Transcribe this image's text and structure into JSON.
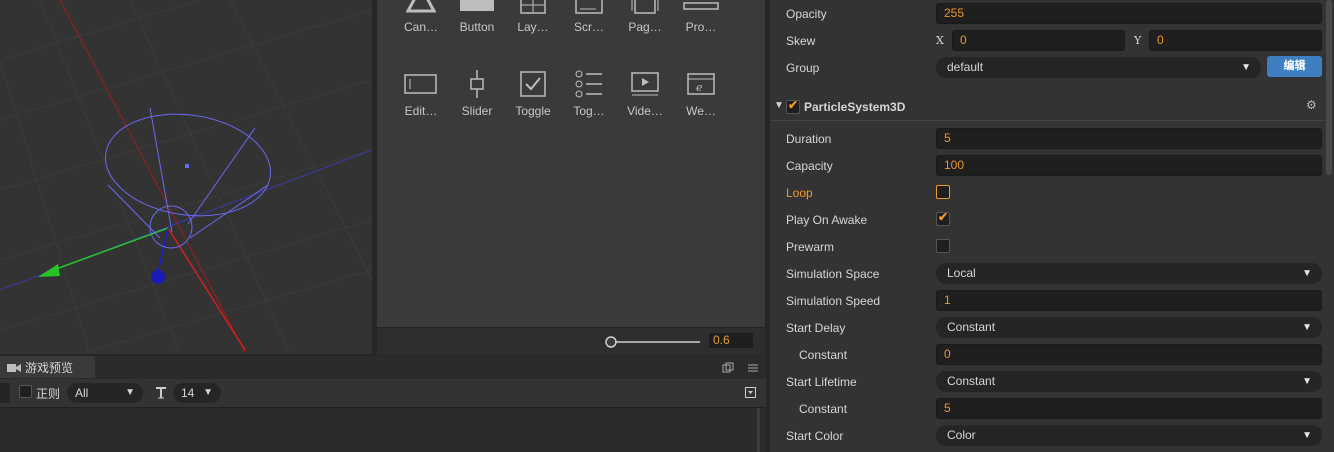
{
  "widgets": [
    {
      "label": "Can…",
      "icon": "canvas-icon"
    },
    {
      "label": "Button",
      "icon": "button-icon"
    },
    {
      "label": "Lay…",
      "icon": "layout-icon"
    },
    {
      "label": "Scr…",
      "icon": "scrollview-icon"
    },
    {
      "label": "Pag…",
      "icon": "pageview-icon"
    },
    {
      "label": "Pro…",
      "icon": "progressbar-icon"
    },
    {
      "label": "Edit…",
      "icon": "editbox-icon"
    },
    {
      "label": "Slider",
      "icon": "slider-icon"
    },
    {
      "label": "Toggle",
      "icon": "toggle-icon"
    },
    {
      "label": "Tog…",
      "icon": "togglegroup-icon"
    },
    {
      "label": "Vide…",
      "icon": "videoplayer-icon"
    },
    {
      "label": "We…",
      "icon": "webview-icon"
    }
  ],
  "zoom": {
    "value": "0.6",
    "level": 0.0
  },
  "preview": {
    "tab_label": "游戏预览",
    "regex_label": "正则",
    "filter_value": "All",
    "font_size": "14"
  },
  "inspector": {
    "opacity": {
      "label": "Opacity",
      "value": "255"
    },
    "skew": {
      "label": "Skew",
      "x_label": "X",
      "x": "0",
      "y_label": "Y",
      "y": "0"
    },
    "group": {
      "label": "Group",
      "value": "default",
      "edit_label": "编辑"
    },
    "component": {
      "title": "ParticleSystem3D",
      "enabled": true
    },
    "rows": {
      "duration": {
        "label": "Duration",
        "value": "5"
      },
      "capacity": {
        "label": "Capacity",
        "value": "100"
      },
      "loop": {
        "label": "Loop",
        "checked": false
      },
      "play_on_awake": {
        "label": "Play On Awake",
        "checked": true
      },
      "prewarm": {
        "label": "Prewarm",
        "checked": false
      },
      "simulation_space": {
        "label": "Simulation Space",
        "value": "Local"
      },
      "simulation_speed": {
        "label": "Simulation Speed",
        "value": "1"
      },
      "start_delay": {
        "label": "Start Delay",
        "value": "Constant"
      },
      "start_delay_constant": {
        "label": "Constant",
        "value": "0"
      },
      "start_lifetime": {
        "label": "Start Lifetime",
        "value": "Constant"
      },
      "start_lifetime_constant": {
        "label": "Constant",
        "value": "5"
      },
      "start_color": {
        "label": "Start Color",
        "value": "Color"
      }
    }
  },
  "colors": {
    "accent": "#f09a2a",
    "edit_button": "#3d7fc1"
  }
}
